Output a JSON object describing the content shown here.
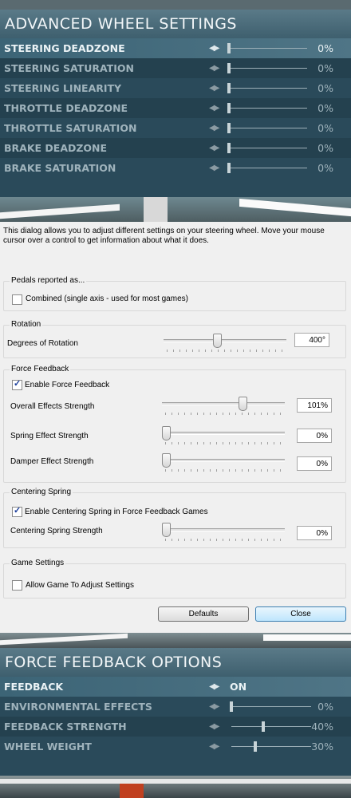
{
  "advanced_panel": {
    "title": "ADVANCED WHEEL SETTINGS",
    "rows": [
      {
        "label": "STEERING DEADZONE",
        "value": "0%",
        "level": 0
      },
      {
        "label": "STEERING SATURATION",
        "value": "0%",
        "level": 0
      },
      {
        "label": "STEERING LINEARITY",
        "value": "0%",
        "level": 0
      },
      {
        "label": "THROTTLE DEADZONE",
        "value": "0%",
        "level": 0
      },
      {
        "label": "THROTTLE SATURATION",
        "value": "0%",
        "level": 0
      },
      {
        "label": "BRAKE DEADZONE",
        "value": "0%",
        "level": 0
      },
      {
        "label": "BRAKE SATURATION",
        "value": "0%",
        "level": 0
      }
    ]
  },
  "dialog": {
    "intro": "This dialog allows you to adjust different settings on your steering wheel.  Move your mouse cursor over a control to get information about what it does.",
    "pedals": {
      "title": "Pedals reported as...",
      "combined_label": "Combined (single axis - used for most games)",
      "combined_checked": false
    },
    "rotation": {
      "title": "Rotation",
      "label": "Degrees of Rotation",
      "value": "400°",
      "level": 0.43
    },
    "force_feedback": {
      "title": "Force Feedback",
      "enable_label": "Enable Force Feedback",
      "enable_checked": true,
      "overall_label": "Overall Effects Strength",
      "overall_value": "101%",
      "overall_level": 0.67,
      "spring_label": "Spring Effect Strength",
      "spring_value": "0%",
      "spring_level": 0,
      "damper_label": "Damper Effect Strength",
      "damper_value": "0%",
      "damper_level": 0
    },
    "centering": {
      "title": "Centering Spring",
      "enable_label": "Enable Centering Spring in Force Feedback Games",
      "enable_checked": true,
      "strength_label": "Centering Spring Strength",
      "strength_value": "0%",
      "strength_level": 0
    },
    "game_settings": {
      "title": "Game Settings",
      "allow_label": "Allow Game To Adjust Settings",
      "allow_checked": false
    },
    "defaults_label": "Defaults",
    "close_label": "Close"
  },
  "ff_panel": {
    "title": "FORCE FEEDBACK OPTIONS",
    "feedback": {
      "label": "FEEDBACK",
      "value": "ON"
    },
    "rows": [
      {
        "label": "ENVIRONMENTAL EFFECTS",
        "value": "0%",
        "level": 0
      },
      {
        "label": "FEEDBACK STRENGTH",
        "value": "40%",
        "level": 0.4
      },
      {
        "label": "WHEEL WEIGHT",
        "value": "30%",
        "level": 0.3
      }
    ]
  }
}
